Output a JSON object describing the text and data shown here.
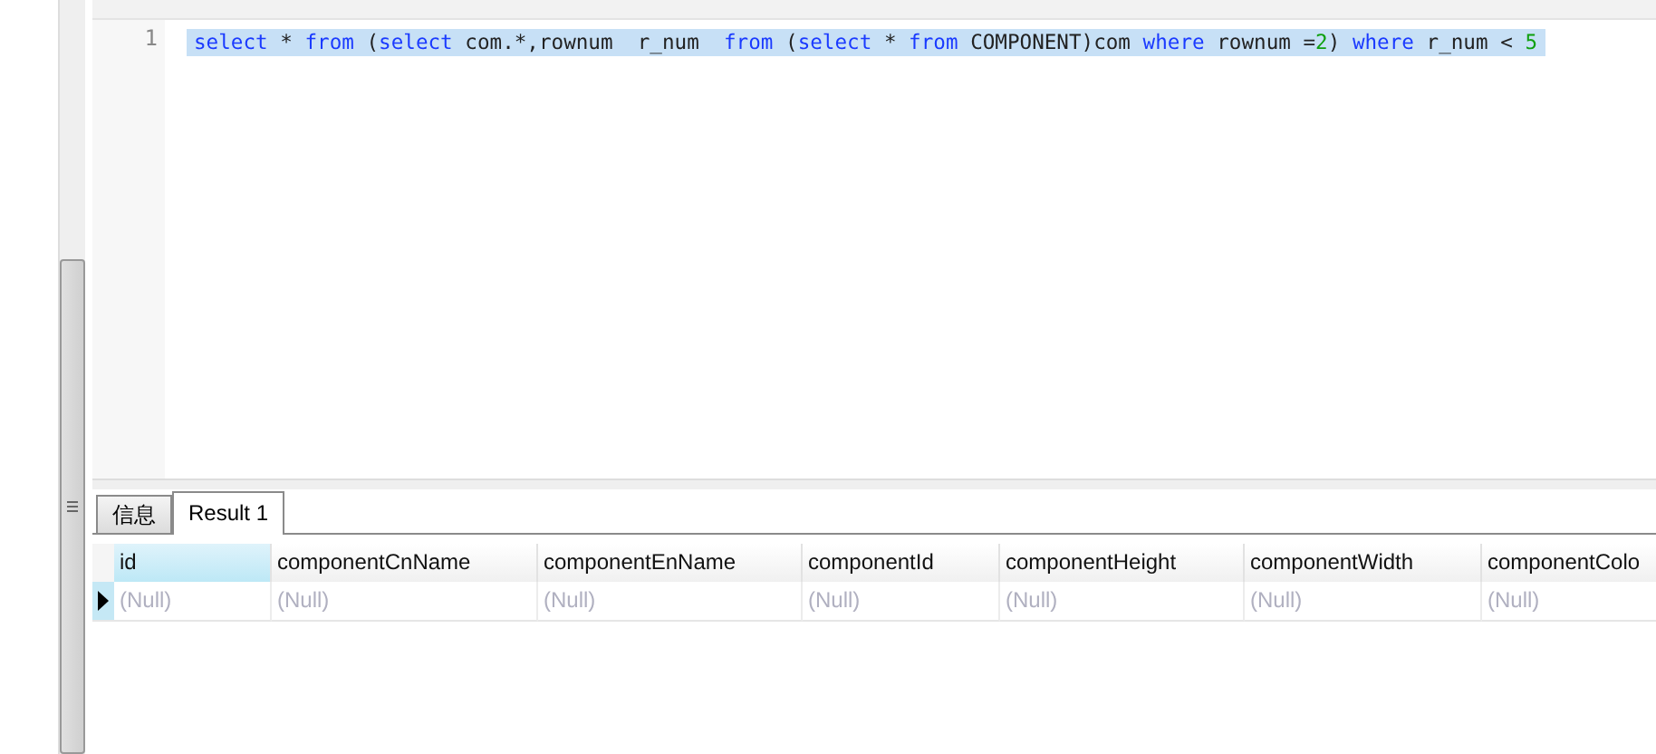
{
  "editor": {
    "lines": [
      {
        "number": "1",
        "selected": true,
        "tokens": [
          {
            "kind": "keyword",
            "text": "select"
          },
          {
            "kind": "plain",
            "text": " * "
          },
          {
            "kind": "keyword",
            "text": "from"
          },
          {
            "kind": "plain",
            "text": " ("
          },
          {
            "kind": "keyword",
            "text": "select"
          },
          {
            "kind": "plain",
            "text": " com.*,rownum  r_num  "
          },
          {
            "kind": "keyword",
            "text": "from"
          },
          {
            "kind": "plain",
            "text": " ("
          },
          {
            "kind": "keyword",
            "text": "select"
          },
          {
            "kind": "plain",
            "text": " * "
          },
          {
            "kind": "keyword",
            "text": "from"
          },
          {
            "kind": "plain",
            "text": " COMPONENT)com "
          },
          {
            "kind": "keyword",
            "text": "where"
          },
          {
            "kind": "plain",
            "text": " rownum ="
          },
          {
            "kind": "number",
            "text": "2"
          },
          {
            "kind": "plain",
            "text": ") "
          },
          {
            "kind": "keyword",
            "text": "where"
          },
          {
            "kind": "plain",
            "text": " r_num < "
          },
          {
            "kind": "number",
            "text": "5"
          }
        ]
      }
    ]
  },
  "tabs": [
    {
      "label": "信息",
      "selected": false
    },
    {
      "label": "Result 1",
      "selected": true
    }
  ],
  "grid": {
    "columns": [
      {
        "label": "id",
        "selected": true
      },
      {
        "label": "componentCnName",
        "selected": false
      },
      {
        "label": "componentEnName",
        "selected": false
      },
      {
        "label": "componentId",
        "selected": false
      },
      {
        "label": "componentHeight",
        "selected": false
      },
      {
        "label": "componentWidth",
        "selected": false
      },
      {
        "label": "componentColo",
        "selected": false
      }
    ],
    "rows": [
      {
        "current": true,
        "cells": [
          "(Null)",
          "(Null)",
          "(Null)",
          "(Null)",
          "(Null)",
          "(Null)",
          "(Null)"
        ]
      }
    ]
  }
}
